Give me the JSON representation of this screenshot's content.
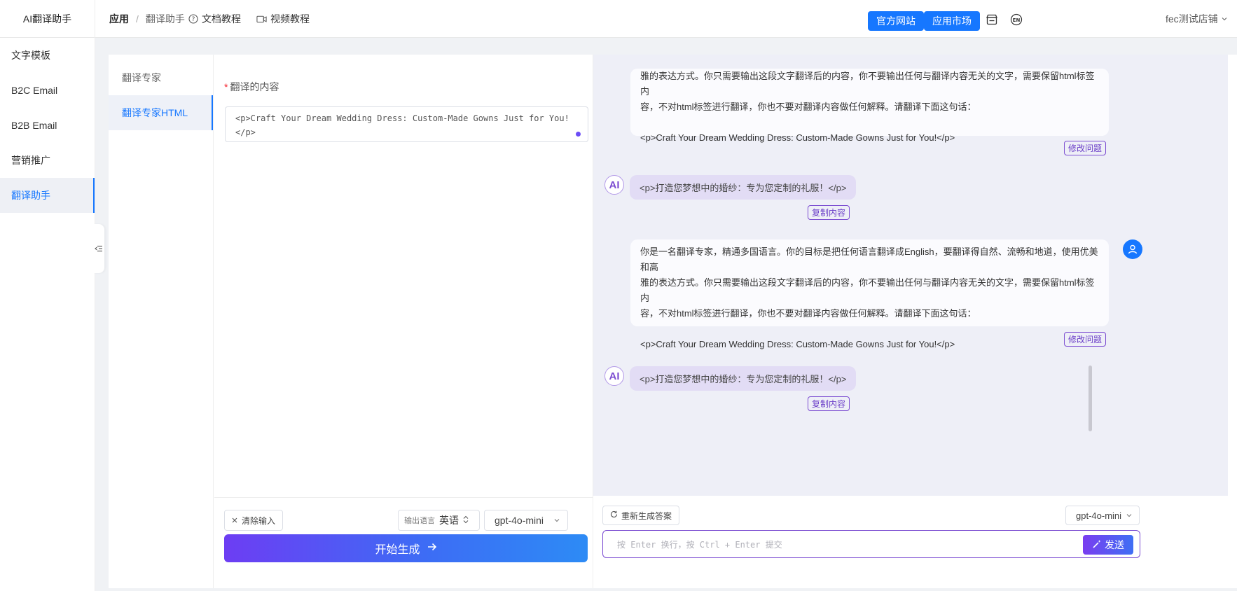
{
  "app": {
    "title": "AI翻译助手"
  },
  "breadcrumb": {
    "root": "应用",
    "separator": "/",
    "current": "翻译助手"
  },
  "top_links": {
    "docs": "文档教程",
    "videos": "视频教程"
  },
  "top_buttons": {
    "official_site": "官方网站",
    "app_market": "应用市场"
  },
  "language_badge": "EN",
  "user": {
    "store_name": "fec测试店铺"
  },
  "sidebar": {
    "items": [
      {
        "label": "文字模板"
      },
      {
        "label": "B2C Email"
      },
      {
        "label": "B2B Email"
      },
      {
        "label": "营销推广"
      },
      {
        "label": "翻译助手"
      }
    ]
  },
  "subnav": {
    "items": [
      {
        "label": "翻译专家"
      },
      {
        "label": "翻译专家HTML"
      }
    ]
  },
  "input": {
    "required_mark": "*",
    "label": "翻译的内容",
    "line1": "<p>Craft Your Dream Wedding Dress: Custom-Made Gowns Just for You!",
    "line2": "</p>"
  },
  "input_footer": {
    "clear_label": "清除输入",
    "output_lang_label": "输出语言",
    "output_lang_value": "英语",
    "model": "gpt-4o-mini",
    "generate_label": "开始生成"
  },
  "chat": {
    "messages": [
      {
        "role": "user",
        "line1": "雅的表达方式。你只需要输出这段文字翻译后的内容，你不要输出任何与翻译内容无关的文字，需要保留html标签内",
        "line2": "容，不对html标签进行翻译，你也不要对翻译内容做任何解释。请翻译下面这句话：",
        "line3": "<p>Craft Your Dream Wedding Dress: Custom-Made Gowns Just for You!</p>",
        "action": "修改问题"
      },
      {
        "role": "ai",
        "avatar": "AI",
        "text": "<p>打造您梦想中的婚纱：专为您定制的礼服！</p>",
        "action": "复制内容"
      },
      {
        "role": "user",
        "line0": "你是一名翻译专家，精通多国语言。你的目标是把任何语言翻译成English，要翻译得自然、流畅和地道，使用优美和高",
        "line1": "雅的表达方式。你只需要输出这段文字翻译后的内容，你不要输出任何与翻译内容无关的文字，需要保留html标签内",
        "line2": "容，不对html标签进行翻译，你也不要对翻译内容做任何解释。请翻译下面这句话：",
        "line3": "<p>Craft Your Dream Wedding Dress: Custom-Made Gowns Just for You!</p>",
        "action": "修改问题"
      },
      {
        "role": "ai",
        "avatar": "AI",
        "text": "<p>打造您梦想中的婚纱：专为您定制的礼服！</p>",
        "action": "复制内容"
      }
    ]
  },
  "chat_footer": {
    "regenerate_label": "重新生成答案",
    "model": "gpt-4o-mini",
    "input_placeholder": "按 Enter 换行，按 Ctrl + Enter 提交",
    "send_label": "发送"
  },
  "colors": {
    "primary": "#1677ff",
    "accent_purple": "#7b4cd1",
    "chat_background": "#eeeff7",
    "ai_bubble": "#e2dcf5"
  }
}
